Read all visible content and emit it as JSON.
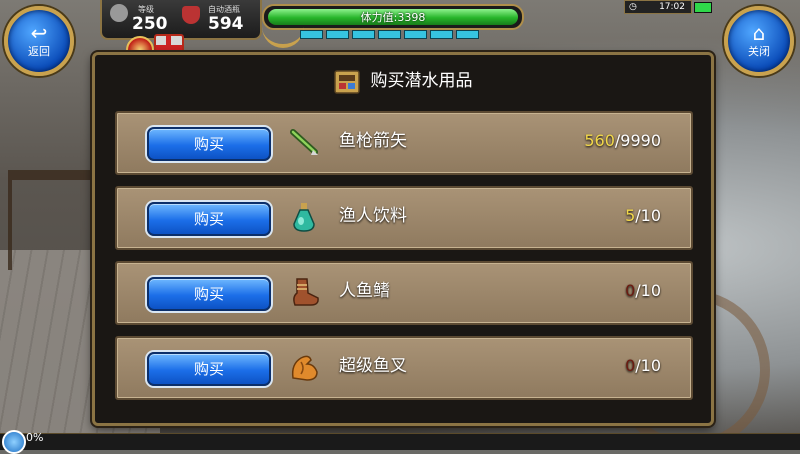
{
  "hud": {
    "back_label": "返回",
    "close_label": "关闭",
    "level_label": "等级",
    "level_value": "250",
    "potion_label": "自动酒瓶",
    "potion_value": "594",
    "stamina_text": "体力值:3398",
    "stamina_fraction": 1.0,
    "energy_segments": 7,
    "clock": "17:02"
  },
  "panel": {
    "title": "购买潜水用品",
    "buy_label": "购买",
    "items": [
      {
        "name": "鱼枪箭矢",
        "icon": "spear-arrow-icon",
        "current": "560",
        "max": "/9990",
        "current_color": "#f2d84a"
      },
      {
        "name": "渔人饮料",
        "icon": "potion-bottle-icon",
        "current": "5",
        "max": "/10",
        "current_color": "#f2d84a"
      },
      {
        "name": "人鱼鳍",
        "icon": "flipper-boot-icon",
        "current": "0",
        "max": "/10",
        "current_color": "#6b1a10"
      },
      {
        "name": "超级鱼叉",
        "icon": "muscle-arm-icon",
        "current": "0",
        "max": "/10",
        "current_color": "#6b1a10"
      }
    ]
  },
  "footer": {
    "progress_text": "0%"
  },
  "colors": {
    "panel_border": "#8b7444",
    "row_bg": "#a99376",
    "buy_button": "#1b6ee8",
    "stamina": "#27b52a"
  }
}
